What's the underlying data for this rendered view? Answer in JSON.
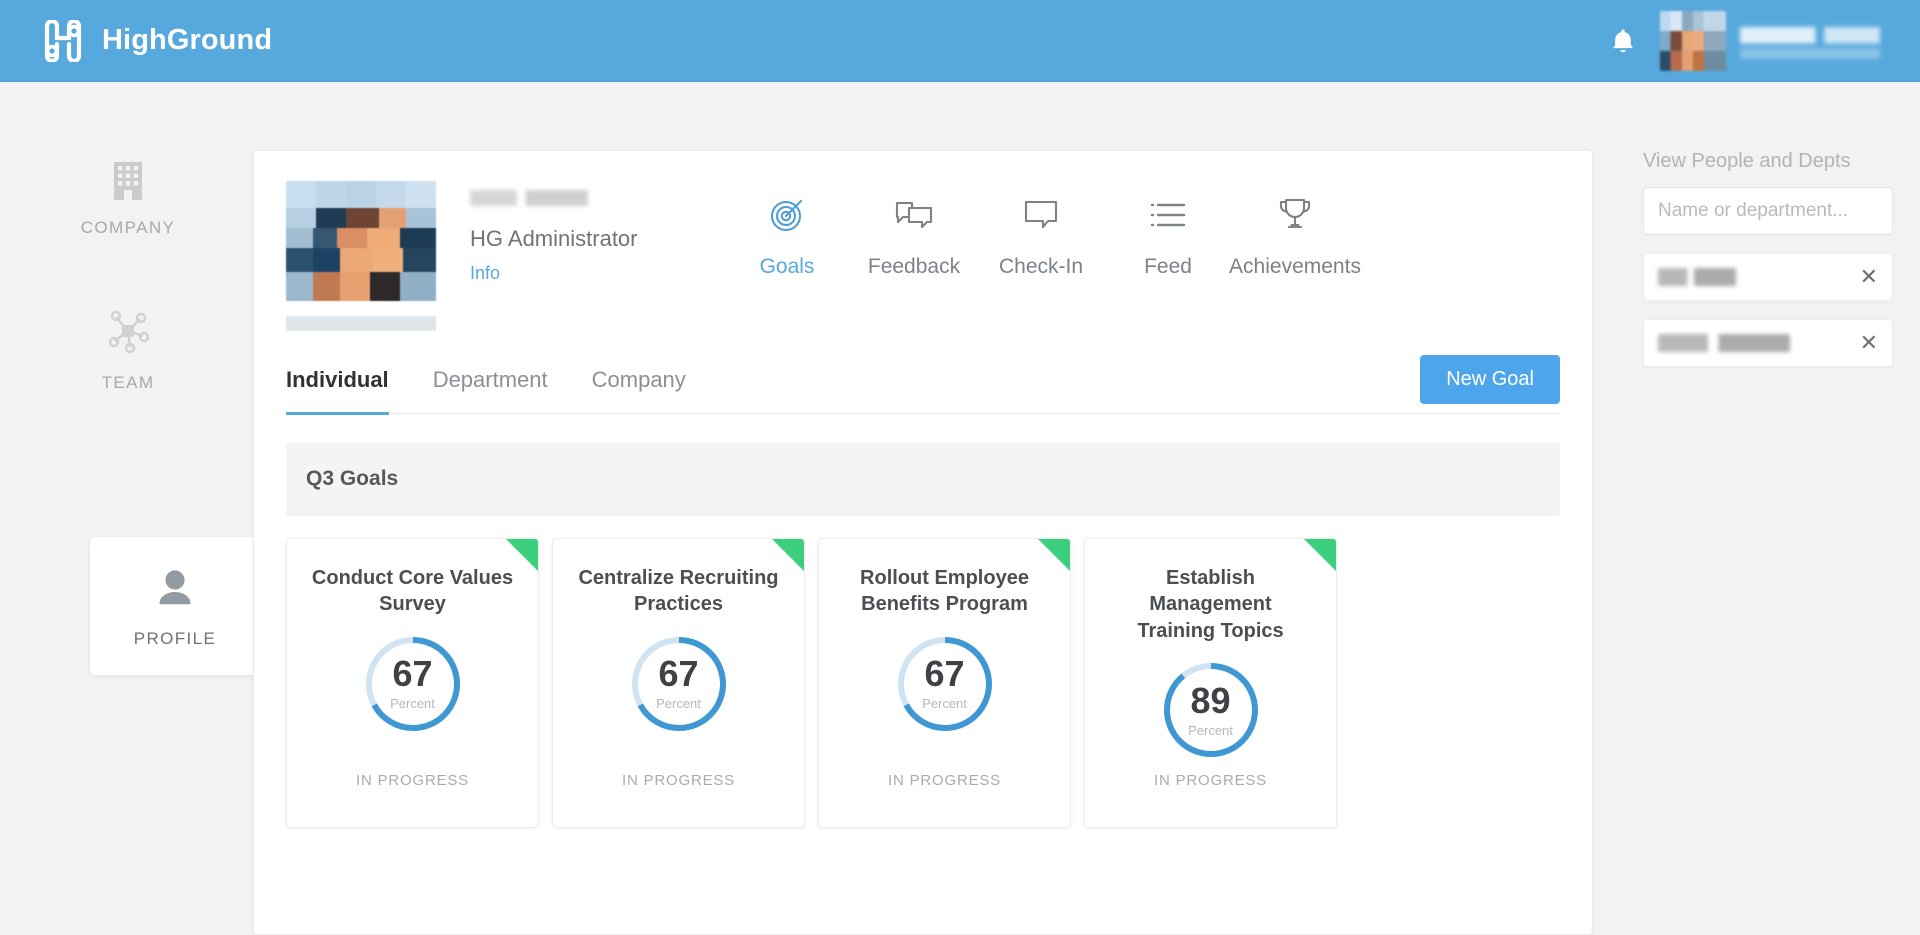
{
  "topbar": {
    "brand_name": "HighGround",
    "logo_icon": "highground-logo-icon",
    "notification_icon": "bell-icon",
    "avatar_alt": "user-avatar",
    "username": "",
    "brand_color": "#56a8dd"
  },
  "left_rail": {
    "items": [
      {
        "label": "COMPANY",
        "icon": "building-icon",
        "active": false
      },
      {
        "label": "TEAM",
        "icon": "network-nodes-icon",
        "active": false
      },
      {
        "label": "PROFILE",
        "icon": "person-icon",
        "active": true
      }
    ]
  },
  "profile": {
    "name": "",
    "role": "HG Administrator",
    "info_link": "Info",
    "avatar_alt": "profile-photo"
  },
  "nav": {
    "items": [
      {
        "label": "Goals",
        "icon": "target-icon",
        "active": true
      },
      {
        "label": "Feedback",
        "icon": "chat-bubbles-icon",
        "active": false
      },
      {
        "label": "Check-In",
        "icon": "speech-bubble-icon",
        "active": false
      },
      {
        "label": "Feed",
        "icon": "list-icon",
        "active": false
      },
      {
        "label": "Achievements",
        "icon": "trophy-icon",
        "active": false
      }
    ]
  },
  "tabs": {
    "items": [
      {
        "label": "Individual",
        "active": true
      },
      {
        "label": "Department",
        "active": false
      },
      {
        "label": "Company",
        "active": false
      }
    ],
    "new_goal_label": "New Goal",
    "accent_color": "#4da6ec"
  },
  "goals": {
    "section_title": "Q3 Goals",
    "unit_label": "Percent",
    "flag_color": "#3ccf7d",
    "ring_color": "#3f97d4",
    "ring_track_color": "#cfe3f2",
    "cards": [
      {
        "title": "Conduct Core Values Survey",
        "percent": 67,
        "status": "IN PROGRESS"
      },
      {
        "title": "Centralize Recruiting Practices",
        "percent": 67,
        "status": "IN PROGRESS"
      },
      {
        "title": "Rollout Employee Benefits Program",
        "percent": 67,
        "status": "IN PROGRESS"
      },
      {
        "title": "Establish Management Training Topics",
        "percent": 89,
        "status": "IN PROGRESS"
      }
    ]
  },
  "right_panel": {
    "title": "View People and Depts",
    "search_placeholder": "Name or department...",
    "search_value": "",
    "chips": [
      {
        "label": "",
        "width": 78,
        "remove_icon": "close-icon"
      },
      {
        "label": "",
        "width": 132,
        "remove_icon": "close-icon"
      }
    ]
  }
}
